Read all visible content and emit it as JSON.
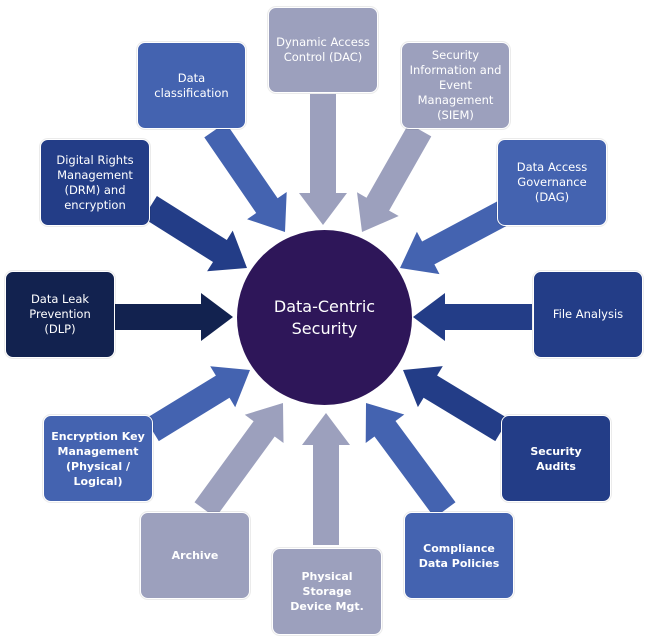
{
  "center": {
    "label": "Data-Centric\nSecurity",
    "color": "#2e1659"
  },
  "colors": {
    "navy": "#12224f",
    "dark_blue": "#233d87",
    "mid_blue": "#4463b0",
    "grey_blue": "#9ca0bd"
  },
  "nodes": [
    {
      "id": "dac",
      "label": "Dynamic Access\nControl (DAC)",
      "color": "#9ca0bd",
      "bold": false
    },
    {
      "id": "siem",
      "label": "Security\nInformation and\nEvent\nManagement\n(SIEM)",
      "color": "#9ca0bd",
      "bold": false
    },
    {
      "id": "dag",
      "label": "Data Access\nGovernance (DAG)",
      "color": "#4463b0",
      "bold": false
    },
    {
      "id": "file-analysis",
      "label": "File Analysis",
      "color": "#233d87",
      "bold": false
    },
    {
      "id": "security-audits",
      "label": "Security\nAudits",
      "color": "#233d87",
      "bold": true
    },
    {
      "id": "compliance",
      "label": "Compliance\nData Policies",
      "color": "#4463b0",
      "bold": true
    },
    {
      "id": "physical-storage",
      "label": "Physical Storage\nDevice Mgt.",
      "color": "#9ca0bd",
      "bold": true
    },
    {
      "id": "archive",
      "label": "Archive",
      "color": "#9ca0bd",
      "bold": true
    },
    {
      "id": "encryption-key",
      "label": "Encryption Key\nManagement\n(Physical / Logical)",
      "color": "#4463b0",
      "bold": true
    },
    {
      "id": "dlp",
      "label": "Data Leak\nPrevention (DLP)",
      "color": "#12224f",
      "bold": false
    },
    {
      "id": "drm",
      "label": "Digital Rights\nManagement\n(DRM) and\nencryption",
      "color": "#233d87",
      "bold": false
    },
    {
      "id": "data-classification",
      "label": "Data classification",
      "color": "#4463b0",
      "bold": false
    }
  ]
}
